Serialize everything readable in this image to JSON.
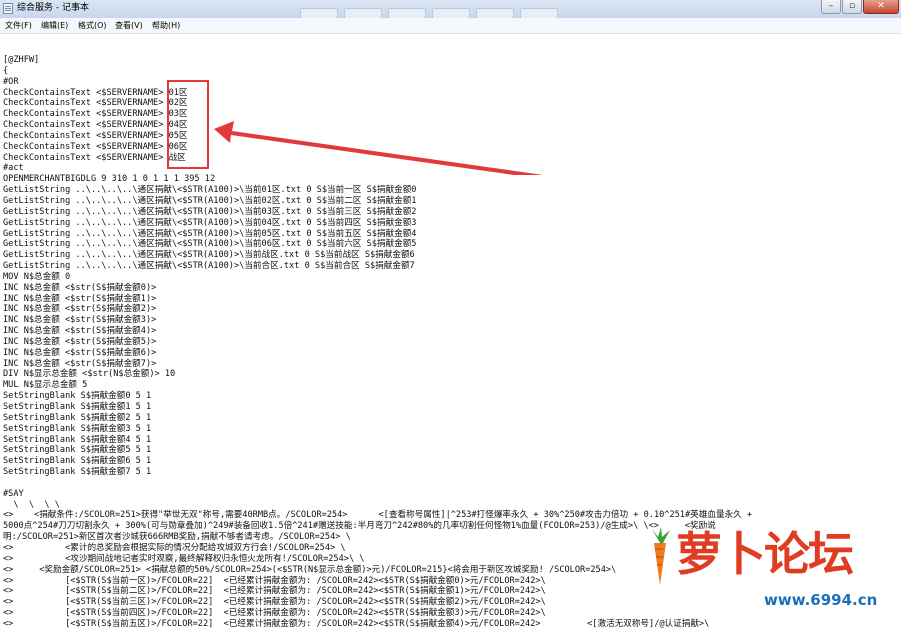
{
  "window": {
    "title": "综合服务 - 记事本"
  },
  "menu": {
    "items": [
      "文件(F)",
      "编辑(E)",
      "格式(O)",
      "查看(V)",
      "帮助(H)"
    ]
  },
  "editor": {
    "lines": [
      "[@ZHFW]",
      "{",
      "#OR",
      "CheckContainsText <$SERVERNAME> 01区",
      "CheckContainsText <$SERVERNAME> 02区",
      "CheckContainsText <$SERVERNAME> 03区",
      "CheckContainsText <$SERVERNAME> 04区",
      "CheckContainsText <$SERVERNAME> 05区",
      "CheckContainsText <$SERVERNAME> 06区",
      "CheckContainsText <$SERVERNAME> 战区",
      "#act",
      "OPENMERCHANTBIGDLG 9 310 1 0 1 1 1 395 12",
      "GetListString ..\\..\\..\\..\\通区捐献\\<$STR(A100)>\\当前01区.txt 0 S$当前一区 S$捐献金额0",
      "GetListString ..\\..\\..\\..\\通区捐献\\<$STR(A100)>\\当前02区.txt 0 S$当前二区 S$捐献金额1",
      "GetListString ..\\..\\..\\..\\通区捐献\\<$STR(A100)>\\当前03区.txt 0 S$当前三区 S$捐献金额2",
      "GetListString ..\\..\\..\\..\\通区捐献\\<$STR(A100)>\\当前04区.txt 0 S$当前四区 S$捐献金额3",
      "GetListString ..\\..\\..\\..\\通区捐献\\<$STR(A100)>\\当前05区.txt 0 S$当前五区 S$捐献金额4",
      "GetListString ..\\..\\..\\..\\通区捐献\\<$STR(A100)>\\当前06区.txt 0 S$当前六区 S$捐献金额5",
      "GetListString ..\\..\\..\\..\\通区捐献\\<$STR(A100)>\\当前战区.txt 0 S$当前战区 S$捐献金额6",
      "GetListString ..\\..\\..\\..\\通区捐献\\<$STR(A100)>\\当前合区.txt 0 S$当前合区 S$捐献金额7",
      "MOV N$总金额 0",
      "INC N$总金额 <$str(S$捐献金额0)>",
      "INC N$总金额 <$str(S$捐献金额1)>",
      "INC N$总金额 <$str(S$捐献金额2)>",
      "INC N$总金额 <$str(S$捐献金额3)>",
      "INC N$总金额 <$str(S$捐献金额4)>",
      "INC N$总金额 <$str(S$捐献金额5)>",
      "INC N$总金额 <$str(S$捐献金额6)>",
      "INC N$总金额 <$str(S$捐献金额7)>",
      "DIV N$显示总金额 <$str(N$总金额)> 10",
      "MUL N$显示总金额 5",
      "SetStringBlank S$捐献金额0 5 1",
      "SetStringBlank S$捐献金额1 5 1",
      "SetStringBlank S$捐献金额2 5 1",
      "SetStringBlank S$捐献金额3 5 1",
      "SetStringBlank S$捐献金额4 5 1",
      "SetStringBlank S$捐献金额5 5 1",
      "SetStringBlank S$捐献金额6 5 1",
      "SetStringBlank S$捐献金额7 5 1",
      "",
      "#SAY",
      "  \\  \\  \\ \\",
      "<>    <捐献条件:/SCOLOR=251>获得\"举世无双\"称号,需要40RMB点。/SCOLOR=254>      <[查看称号属性]|^253#打怪爆率永久 + 30%^250#攻击力倍功 + 0.10^251#英雄血量永久 +",
      "5000点^254#刀刀切割永久 + 300%(可与勋章叠加)^249#装备回收1.5倍^241#赠送技能:半月弯刀^242#80%的几率切割任何怪物1%血量(FCOLOR=253)/@生成>\\ \\<>     <奖励说",
      "明:/SCOLOR=251>新区首次者沙城获666RMB奖励,捐献不够者请考虑。/SCOLOR=254> \\",
      "<>          <累计的总奖励会根据实际的情况分配给攻城双方行会!/SCOLOR=254> \\",
      "<>          <攻沙期间战地记者实时观察,最终解释权归永恒火龙所有!/SCOLOR=254>\\ \\",
      "<>     <奖励金额/SCOLOR=251> <捐献总额的50%/SCOLOR=254>(<$STR(N$显示总金额)>元)/FCOLOR=215}<将会用于新区攻城奖励! /SCOLOR=254>\\",
      "<>          [<$STR(S$当前一区)>/FCOLOR=22]  <已经累计捐献金额为: /SCOLOR=242><$STR(S$捐献金额0)>元/FCOLOR=242>\\",
      "<>          [<$STR(S$当前二区)>/FCOLOR=22]  <已经累计捐献金额为: /SCOLOR=242><$STR(S$捐献金额1)>元/FCOLOR=242>\\",
      "<>          [<$STR(S$当前三区)>/FCOLOR=22]  <已经累计捐献金额为: /SCOLOR=242><$STR(S$捐献金额2)>元/FCOLOR=242>\\",
      "<>          [<$STR(S$当前四区)>/FCOLOR=22]  <已经累计捐献金额为: /SCOLOR=242><$STR(S$捐献金额3)>元/FCOLOR=242>\\",
      "<>          [<$STR(S$当前五区)>/FCOLOR=22]  <已经累计捐献金额为: /SCOLOR=242><$STR(S$捐献金额4)>元/FCOLOR=242>         <[激活无双称号]/@认证捐献>\\"
    ]
  },
  "watermark": {
    "text": "萝卜论坛",
    "url": "www.6994.cn"
  },
  "colors": {
    "highlight": "#e23a3a",
    "watermark_red": "#e03c22",
    "watermark_blue": "#1b6fb8"
  }
}
